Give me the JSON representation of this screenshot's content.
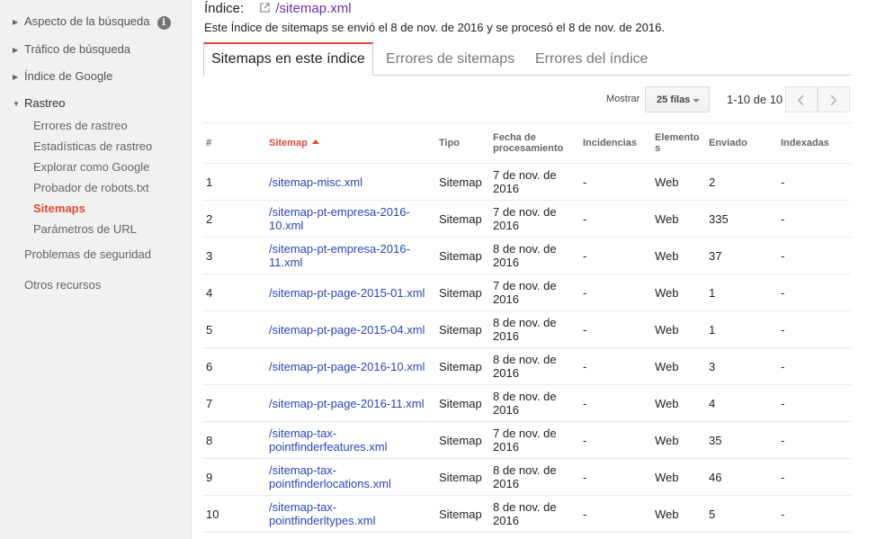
{
  "sidebar": {
    "items": [
      {
        "label": "Aspecto de la búsqueda"
      },
      {
        "label": "Tráfico de búsqueda"
      },
      {
        "label": "Índice de Google"
      },
      {
        "label": "Rastreo"
      }
    ],
    "info_glyph": "i",
    "crawl_subitems": [
      {
        "label": "Errores de rastreo"
      },
      {
        "label": "Estadísticas de rastreo"
      },
      {
        "label": "Explorar como Google"
      },
      {
        "label": "Probador de robots.txt"
      },
      {
        "label": "Sitemaps"
      },
      {
        "label": "Parámetros de URL"
      }
    ],
    "other_items": [
      {
        "label": "Problemas de seguridad"
      },
      {
        "label": "Otros recursos"
      }
    ]
  },
  "header": {
    "index_label": "Índice:",
    "index_link": "/sitemap.xml",
    "description": "Este Índice de sitemaps se envió el 8 de nov. de 2016 y se procesó el 8 de nov. de 2016."
  },
  "tabs": [
    {
      "label": "Sitemaps en este índice"
    },
    {
      "label": "Errores de sitemaps"
    },
    {
      "label": "Errores del índice"
    }
  ],
  "pager": {
    "show_label": "Mostrar",
    "rows_value": "25 filas",
    "range": "1-10 de 10"
  },
  "table": {
    "headers": {
      "num": "#",
      "sitemap": "Sitemap",
      "type": "Tipo",
      "date_line1": "Fecha de",
      "date_line2": "procesamiento",
      "issues": "Incidencias",
      "items_line1": "Elemento",
      "items_line2": "s",
      "submitted": "Enviado",
      "indexed": "Indexadas"
    },
    "rows": [
      {
        "num": "1",
        "sitemap": "/sitemap-misc.xml",
        "type": "Sitemap",
        "date": "7 de nov. de 2016",
        "issues": "-",
        "items": "Web",
        "submitted": "2",
        "indexed": "-"
      },
      {
        "num": "2",
        "sitemap": "/sitemap-pt-empresa-2016-10.xml",
        "type": "Sitemap",
        "date": "7 de nov. de 2016",
        "issues": "-",
        "items": "Web",
        "submitted": "335",
        "indexed": "-"
      },
      {
        "num": "3",
        "sitemap": "/sitemap-pt-empresa-2016-11.xml",
        "type": "Sitemap",
        "date": "8 de nov. de 2016",
        "issues": "-",
        "items": "Web",
        "submitted": "37",
        "indexed": "-"
      },
      {
        "num": "4",
        "sitemap": "/sitemap-pt-page-2015-01.xml",
        "type": "Sitemap",
        "date": "7 de nov. de 2016",
        "issues": "-",
        "items": "Web",
        "submitted": "1",
        "indexed": "-"
      },
      {
        "num": "5",
        "sitemap": "/sitemap-pt-page-2015-04.xml",
        "type": "Sitemap",
        "date": "8 de nov. de 2016",
        "issues": "-",
        "items": "Web",
        "submitted": "1",
        "indexed": "-"
      },
      {
        "num": "6",
        "sitemap": "/sitemap-pt-page-2016-10.xml",
        "type": "Sitemap",
        "date": "8 de nov. de 2016",
        "issues": "-",
        "items": "Web",
        "submitted": "3",
        "indexed": "-"
      },
      {
        "num": "7",
        "sitemap": "/sitemap-pt-page-2016-11.xml",
        "type": "Sitemap",
        "date": "8 de nov. de 2016",
        "issues": "-",
        "items": "Web",
        "submitted": "4",
        "indexed": "-"
      },
      {
        "num": "8",
        "sitemap": "/sitemap-tax-pointfinderfeatures.xml",
        "type": "Sitemap",
        "date": "7 de nov. de 2016",
        "issues": "-",
        "items": "Web",
        "submitted": "35",
        "indexed": "-"
      },
      {
        "num": "9",
        "sitemap": "/sitemap-tax-pointfinderlocations.xml",
        "type": "Sitemap",
        "date": "8 de nov. de 2016",
        "issues": "-",
        "items": "Web",
        "submitted": "46",
        "indexed": "-"
      },
      {
        "num": "10",
        "sitemap": "/sitemap-tax-pointfinderltypes.xml",
        "type": "Sitemap",
        "date": "8 de nov. de 2016",
        "issues": "-",
        "items": "Web",
        "submitted": "5",
        "indexed": "-"
      }
    ]
  },
  "colors": {
    "accent_red": "#dd4b39",
    "link_blue": "#2a46b8",
    "visited_purple": "#6633aa",
    "sidebar_bg": "#f1f1f1"
  },
  "icons": [
    "info-icon",
    "external-link-icon",
    "chevron-left-icon",
    "chevron-right-icon",
    "sort-asc-icon",
    "caret-down-icon"
  ]
}
